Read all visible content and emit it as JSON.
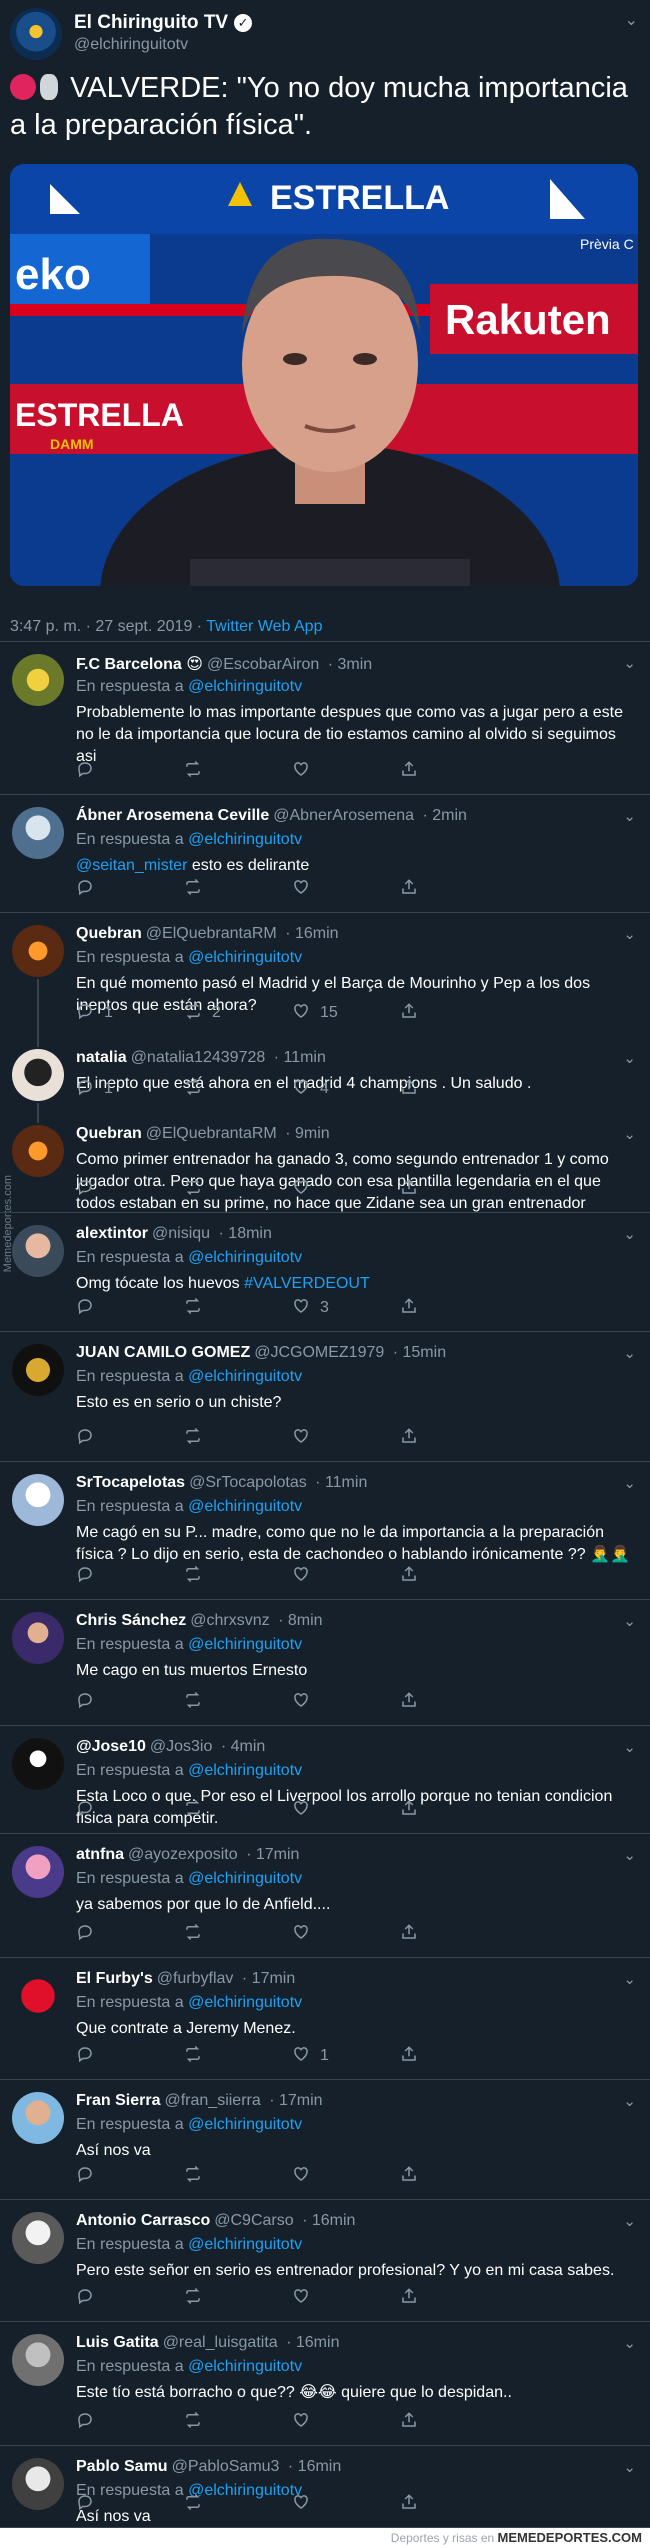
{
  "main_tweet": {
    "name": "El Chiringuito TV",
    "handle": "@elchiringuitotv",
    "text": "VALVERDE: \"Yo no doy mucha importancia a la preparación física\".",
    "emojis": [
      "red-circle-icon",
      "microphone-icon"
    ],
    "media_words": [
      "ESTRELLA",
      "DAMM",
      "Rakuten",
      "Prèvia C",
      "eko",
      "ESTRELLA"
    ],
    "timestamp": "3:47 p. m. · 27 sept. 2019 · ",
    "source": "Twitter Web App"
  },
  "in_reply_label": "En respuesta a",
  "in_reply_handle": "@elchiringuitotv",
  "replies": [
    {
      "name": "F.C Barcelona",
      "emoji": "😍",
      "handle": "@EscobarAiron",
      "time": "· 3min",
      "in_reply": true,
      "text": "Probablemente lo mas importante despues que como vas a jugar pero a este no le da importancia que locura de tio estamos camino al olvido si seguimos asi",
      "counts": [
        "",
        "",
        ""
      ]
    },
    {
      "name": "Ábner Arosemena Ceville",
      "handle": "@AbnerArosemena",
      "time": "· 2min",
      "in_reply": true,
      "mention": "@seitan_mister",
      "text": " esto es delirante",
      "counts": [
        "",
        "",
        ""
      ]
    },
    {
      "name": "Quebran",
      "handle": "@ElQuebrantaRM",
      "time": "· 16min",
      "in_reply": true,
      "text": "En qué momento pasó el Madrid y el Barça de Mourinho y Pep a los dos ineptos que están ahora?",
      "counts": [
        "1",
        "2",
        "15"
      ]
    },
    {
      "name": "natalia",
      "handle": "@natalia12439728",
      "time": "· 11min",
      "in_reply": false,
      "text": "El inepto que está ahora en el madrid 4 champions . Un saludo .",
      "counts": [
        "1",
        "",
        "4"
      ]
    },
    {
      "name": "Quebran",
      "handle": "@ElQuebrantaRM",
      "time": "· 9min",
      "in_reply": false,
      "text": "Como primer entrenador ha ganado 3, como segundo entrenador 1 y como jugador otra. Pero que haya ganado con esa plantilla legendaria en el que todos estaban en su prime, no hace que Zidane sea un gran entrenador",
      "counts": [
        "",
        "",
        ""
      ]
    },
    {
      "name": "alextintor",
      "handle": "@nisiqu",
      "time": "· 18min",
      "in_reply": true,
      "text": "Omg tócate los huevos ",
      "hashtag": "#VALVERDEOUT",
      "counts": [
        "",
        "",
        "3"
      ]
    },
    {
      "name": "JUAN CAMILO GOMEZ",
      "handle": "@JCGOMEZ1979",
      "time": "· 15min",
      "in_reply": true,
      "text": "Esto es en serio o un chiste?",
      "counts": [
        "",
        "",
        ""
      ]
    },
    {
      "name": "SrTocapelotas",
      "handle": "@SrTocapolotas",
      "time": "· 11min",
      "in_reply": true,
      "text": "Me cagó en su P... madre, como que no le da importancia a la preparación física ? Lo dijo en serio, esta de cachondeo o hablando irónicamente ?? 🤦‍♂️🤦‍♂️",
      "counts": [
        "",
        "",
        ""
      ]
    },
    {
      "name": "Chris Sánchez",
      "handle": "@chrxsvnz",
      "time": "· 8min",
      "in_reply": true,
      "text": "Me cago en tus muertos Ernesto",
      "counts": [
        "",
        "",
        ""
      ]
    },
    {
      "name": "@Jose10",
      "handle": "@Jos3io",
      "time": "· 4min",
      "in_reply": true,
      "text": "Esta Loco o que. Por eso el Liverpool los arrollo porque no tenian condicion fisica para competir.",
      "counts": [
        "",
        "",
        ""
      ]
    },
    {
      "name": "atnfna",
      "handle": "@ayozexposito",
      "time": "· 17min",
      "in_reply": true,
      "text": "ya sabemos por que lo de Anfield....",
      "counts": [
        "",
        "",
        ""
      ]
    },
    {
      "name": "El Furby's",
      "handle": "@furbyflav",
      "time": "· 17min",
      "in_reply": true,
      "text": "Que contrate a Jeremy Menez.",
      "counts": [
        "",
        "",
        "1"
      ]
    },
    {
      "name": "Fran Sierra",
      "handle": "@fran_siierra",
      "time": "· 17min",
      "in_reply": true,
      "text": "Así nos va",
      "counts": [
        "",
        "",
        ""
      ]
    },
    {
      "name": "Antonio Carrasco",
      "handle": "@C9Carso",
      "time": "· 16min",
      "in_reply": true,
      "text": "Pero este señor en serio es entrenador profesional? Y yo en mi casa sabes.",
      "counts": [
        "",
        "",
        ""
      ]
    },
    {
      "name": "Luis Gatita",
      "handle": "@real_luisgatita",
      "time": "· 16min",
      "in_reply": true,
      "text": "Este tío está borracho o que?? 😂😂 quiere que lo despidan..",
      "counts": [
        "",
        "",
        ""
      ]
    },
    {
      "name": "Pablo Samu",
      "handle": "@PabloSamu3",
      "time": "· 16min",
      "in_reply": true,
      "text": "Así nos va",
      "counts": [
        "",
        "",
        ""
      ]
    }
  ],
  "watermark_side": "Memedeportes.com",
  "footer_text": "Deportes y risas en",
  "footer_brand": "MEMEDEPORTES.COM",
  "colors": {
    "bg": "#15202b",
    "border": "#38444d",
    "muted": "#8899a6",
    "link": "#1da1f2"
  }
}
